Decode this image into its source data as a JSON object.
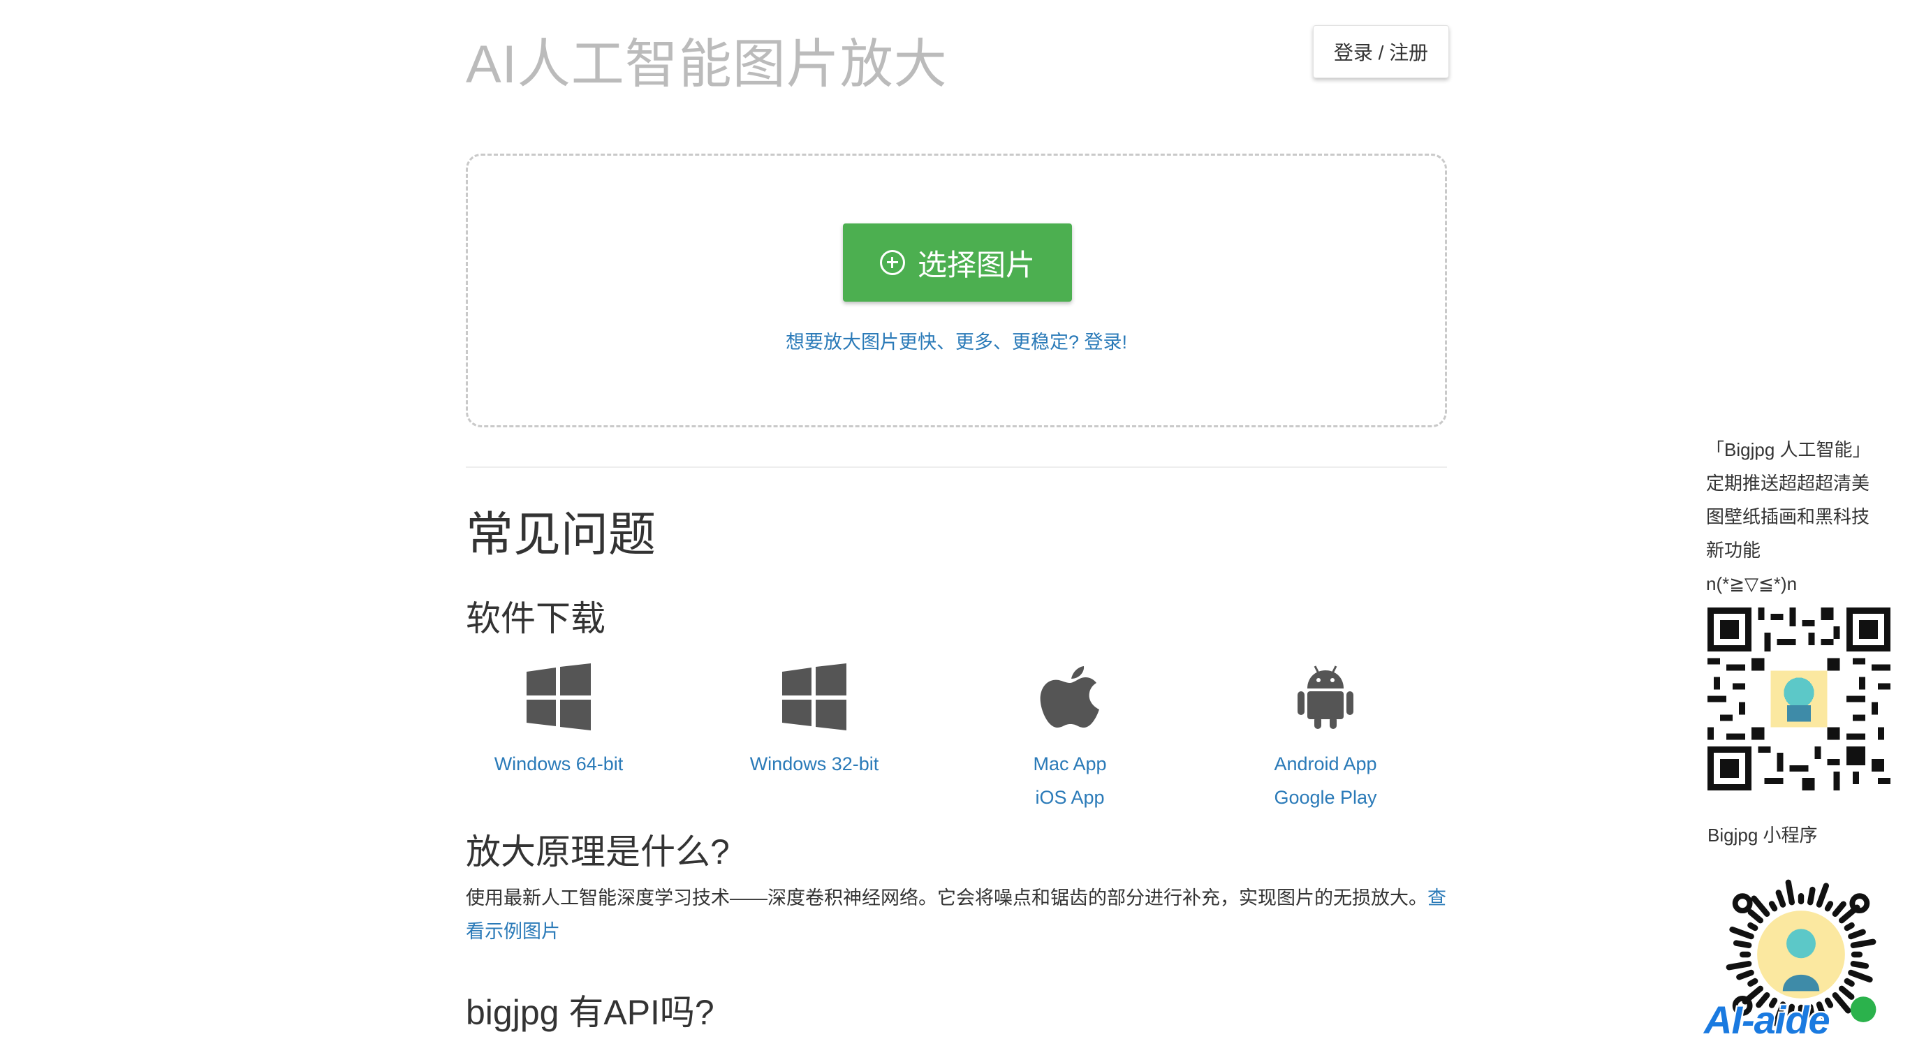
{
  "header": {
    "site_title": "AI人工智能图片放大",
    "login_label": "登录 / 注册"
  },
  "upload": {
    "button_label": "选择图片",
    "hint": "想要放大图片更快、更多、更稳定? 登录!"
  },
  "faq": {
    "title": "常见问题",
    "download_title": "软件下载",
    "downloads": [
      {
        "icon": "windows-icon",
        "links": [
          "Windows 64-bit"
        ]
      },
      {
        "icon": "windows-icon",
        "links": [
          "Windows 32-bit"
        ]
      },
      {
        "icon": "apple-icon",
        "links": [
          "Mac App",
          "iOS App"
        ]
      },
      {
        "icon": "android-icon",
        "links": [
          "Android App",
          "Google Play"
        ]
      }
    ],
    "q1_title": "放大原理是什么?",
    "q1_body": "使用最新人工智能深度学习技术——深度卷积神经网络。它会将噪点和锯齿的部分进行补充，实现图片的无损放大。",
    "q1_link": "查看示例图片",
    "q2_title": "bigjpg 有API吗?"
  },
  "sidebar": {
    "lines": [
      "「Bigjpg 人工智能」",
      "定期推送超超超清美",
      "图壁纸插画和黑科技",
      "新功能",
      "n(*≧▽≦*)n"
    ],
    "mini_label": "Bigjpg 小程序",
    "watermark": "AI-aide"
  },
  "colors": {
    "primary_green": "#4caf50",
    "link_blue": "#2a7ab8",
    "title_gray": "#bbbbbb"
  }
}
